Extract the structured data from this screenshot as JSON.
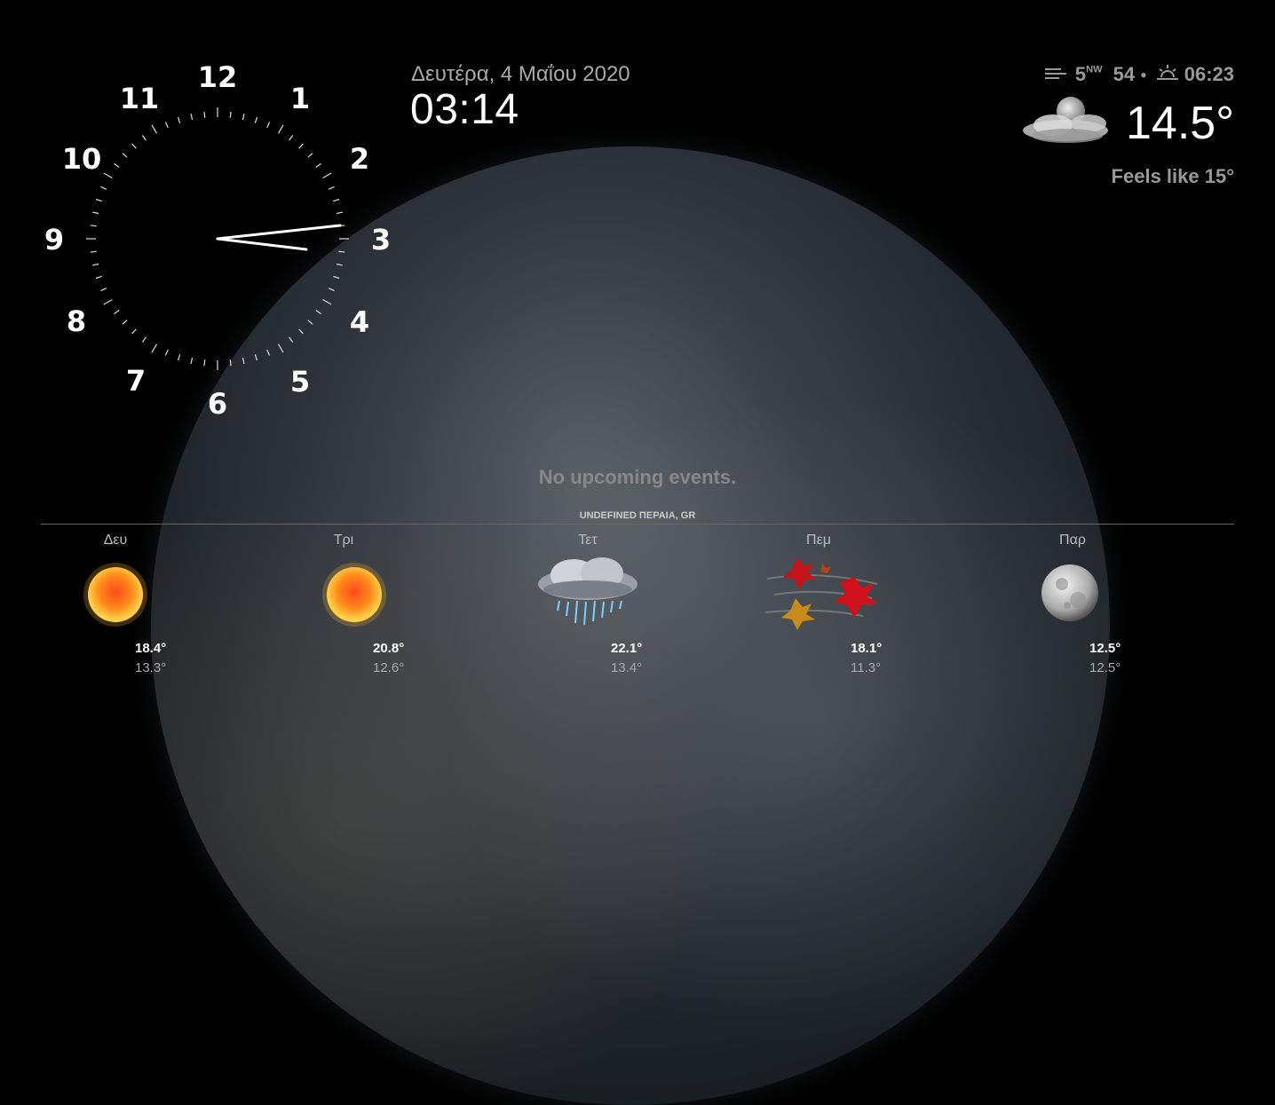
{
  "clock": {
    "numerals": [
      "12",
      "1",
      "2",
      "3",
      "4",
      "5",
      "6",
      "7",
      "8",
      "9",
      "10",
      "11"
    ]
  },
  "datetime": {
    "date": "Δευτέρα, 4 Μαΐου 2020",
    "time": "03:14"
  },
  "current_weather": {
    "wind_speed": "5",
    "wind_direction": "NW",
    "humidity": "54",
    "sunrise": "06:23",
    "temperature": "14.5°",
    "feels_like": "Feels like 15°",
    "icon": "night-cloudy-icon"
  },
  "events": {
    "message": "No upcoming events."
  },
  "forecast": {
    "location": "UNDEFINED ΠΕΡΑΙΑ, GR",
    "days": [
      {
        "day": "Δευ",
        "max": "18.4°",
        "min": "13.3°",
        "icon": "sun-icon"
      },
      {
        "day": "Τρι",
        "max": "20.8°",
        "min": "12.6°",
        "icon": "sun-icon"
      },
      {
        "day": "Τετ",
        "max": "22.1°",
        "min": "13.4°",
        "icon": "rain-cloud-icon"
      },
      {
        "day": "Πεμ",
        "max": "18.1°",
        "min": "11.3°",
        "icon": "windy-leaves-icon"
      },
      {
        "day": "Παρ",
        "max": "12.5°",
        "min": "12.5°",
        "icon": "moon-icon"
      }
    ]
  }
}
